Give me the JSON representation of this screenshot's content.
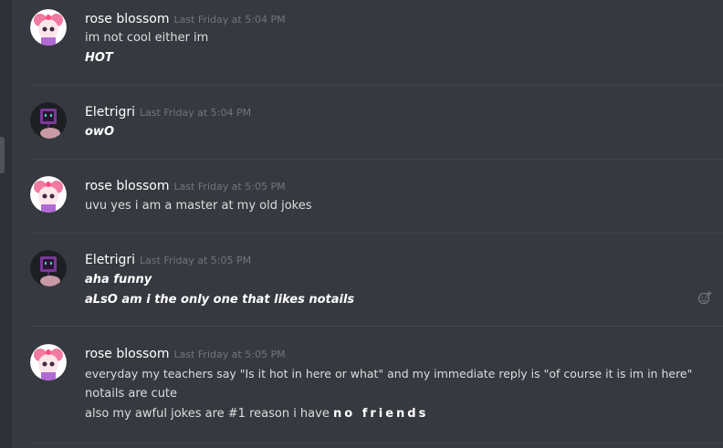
{
  "users": {
    "rose": "rose blossom",
    "eletrigri": "Eletrigri"
  },
  "messages": [
    {
      "author": "rose blossom",
      "timestamp": "Last Friday at 5:04 PM",
      "lines": [
        "im not cool either im",
        "HOT"
      ]
    },
    {
      "author": "Eletrigri",
      "timestamp": "Last Friday at 5:04 PM",
      "lines": [
        "owO"
      ]
    },
    {
      "author": "rose blossom",
      "timestamp": "Last Friday at 5:05 PM",
      "lines": [
        "uvu yes i am a master at my old jokes"
      ]
    },
    {
      "author": "Eletrigri",
      "timestamp": "Last Friday at 5:05 PM",
      "lines": [
        "aha funny",
        "aLsO am i the only one that likes notails"
      ]
    },
    {
      "author": "rose blossom",
      "timestamp": "Last Friday at 5:05 PM",
      "lines": [
        "everyday my teachers say \"Is it hot in here or what\" and my immediate reply is \"of course it is im in here\"",
        "notails are cute",
        "also my awful jokes are #1 reason i have",
        "no friends"
      ]
    }
  ],
  "icons": {
    "add_reaction": "add-reaction-icon"
  },
  "colors": {
    "background": "#36393f",
    "username": "#ffffff",
    "timestamp": "#72767d",
    "text": "#dcddde"
  }
}
